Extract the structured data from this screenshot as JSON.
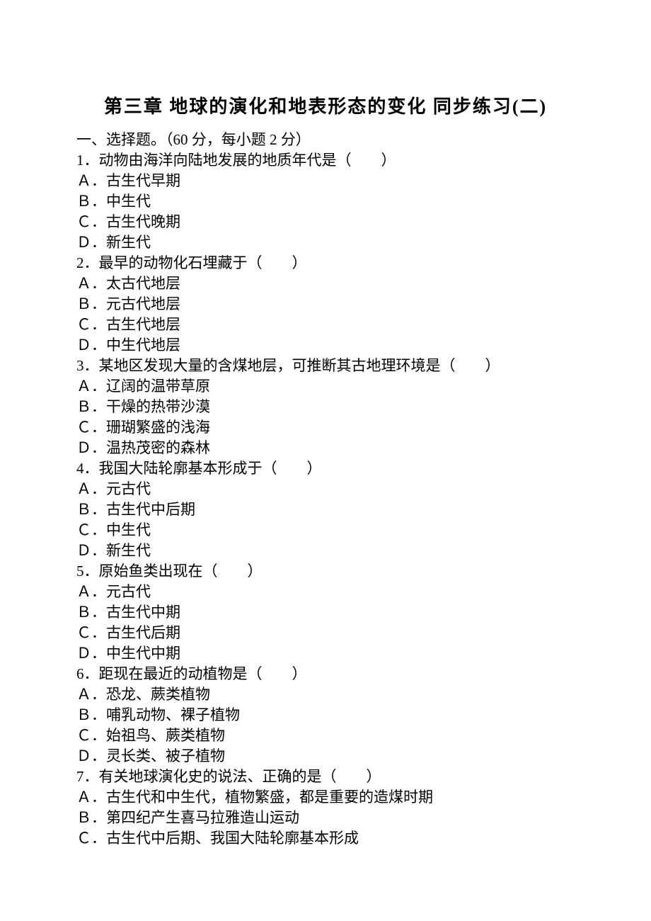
{
  "title": "第三章 地球的演化和地表形态的变化 同步练习(二)",
  "section_header": "一、选择题。（60 分，每小题 2 分）",
  "questions": [
    {
      "stem": "1．动物由海洋向陆地发展的地质年代是（　　）",
      "options": [
        "Ａ．古生代早期",
        "Ｂ．中生代",
        "Ｃ．古生代晚期",
        "Ｄ．新生代"
      ]
    },
    {
      "stem": "2．最早的动物化石埋藏于（　　）",
      "options": [
        "Ａ．太古代地层",
        "Ｂ．元古代地层",
        "Ｃ．古生代地层",
        "Ｄ．中生代地层"
      ]
    },
    {
      "stem": "3．某地区发现大量的含煤地层，可推断其古地理环境是（　　）",
      "options": [
        "Ａ．辽阔的温带草原",
        "Ｂ．干燥的热带沙漠",
        "Ｃ．珊瑚繁盛的浅海",
        "Ｄ．温热茂密的森林"
      ]
    },
    {
      "stem": "4．我国大陆轮廓基本形成于（　　）",
      "options": [
        "Ａ．元古代",
        "Ｂ．古生代中后期",
        "Ｃ．中生代",
        "Ｄ．新生代"
      ]
    },
    {
      "stem": "5．原始鱼类出现在（　　）",
      "options": [
        "Ａ．元古代",
        "Ｂ．古生代中期",
        "Ｃ．古生代后期",
        "Ｄ．中生代中期"
      ]
    },
    {
      "stem": "6．距现在最近的动植物是（　　）",
      "options": [
        "Ａ．恐龙、蕨类植物",
        "Ｂ．哺乳动物、裸子植物",
        "Ｃ．始祖鸟、蕨类植物",
        "Ｄ．灵长类、被子植物"
      ]
    },
    {
      "stem": "7．有关地球演化史的说法、正确的是（　　）",
      "options": [
        "Ａ．古生代和中生代，植物繁盛，都是重要的造煤时期",
        "Ｂ．第四纪产生喜马拉雅造山运动",
        "Ｃ．古生代中后期、我国大陆轮廓基本形成"
      ]
    }
  ]
}
